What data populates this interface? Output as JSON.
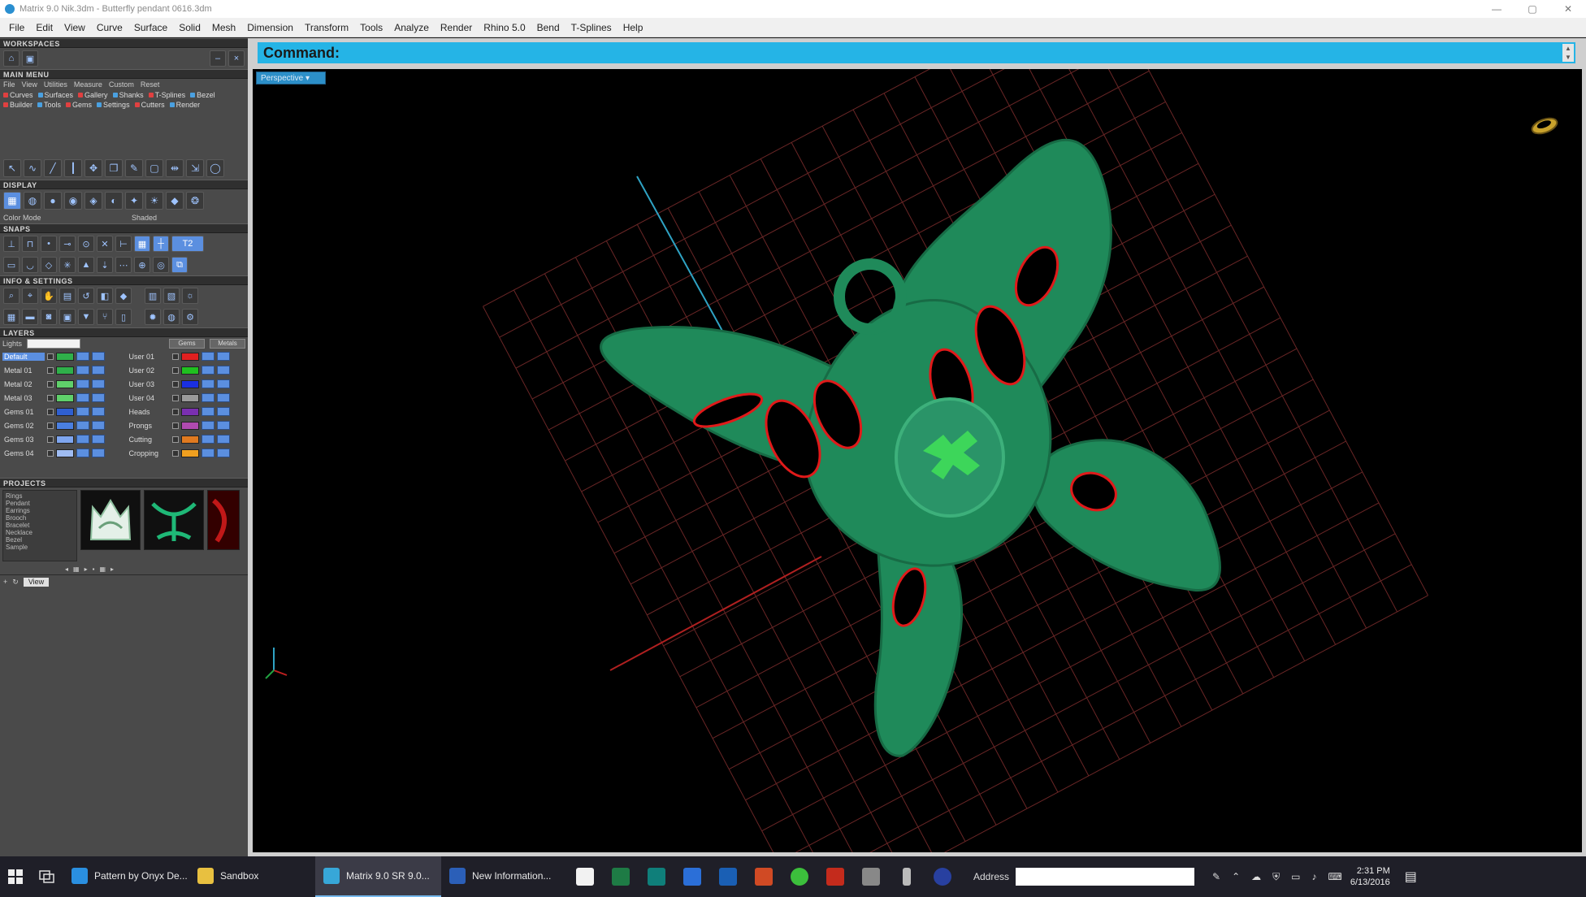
{
  "window": {
    "title": "Matrix 9.0 Nik.3dm - Butterfly pendant 0616.3dm",
    "min": "—",
    "max": "▢",
    "close": "✕"
  },
  "menu": [
    "File",
    "Edit",
    "View",
    "Curve",
    "Surface",
    "Solid",
    "Mesh",
    "Dimension",
    "Transform",
    "Tools",
    "Analyze",
    "Render",
    "Rhino 5.0",
    "Bend",
    "T-Splines",
    "Help"
  ],
  "left_panel": {
    "sections": {
      "workspaces": "WORKSPACES",
      "main_menu": "MAIN MENU",
      "display": "DISPLAY",
      "snaps": "SNAPS",
      "info_settings": "INFO & SETTINGS",
      "layers": "LAYERS",
      "projects": "PROJECTS"
    },
    "main_menu_tabs": [
      "File",
      "View",
      "Utilities",
      "Measure",
      "Custom",
      "Reset"
    ],
    "main_menu_chips": [
      {
        "label": "Curves",
        "color": "#e04040"
      },
      {
        "label": "Surfaces",
        "color": "#4aa0e0"
      },
      {
        "label": "Gallery",
        "color": "#e04040"
      },
      {
        "label": "Shanks",
        "color": "#4aa0e0"
      },
      {
        "label": "T-Splines",
        "color": "#e04040"
      },
      {
        "label": "Bezel",
        "color": "#4aa0e0"
      },
      {
        "label": "Builder",
        "color": "#e04040"
      },
      {
        "label": "Tools",
        "color": "#4aa0e0"
      },
      {
        "label": "Gems",
        "color": "#e04040"
      },
      {
        "label": "Settings",
        "color": "#4aa0e0"
      },
      {
        "label": "Cutters",
        "color": "#e04040"
      },
      {
        "label": "Render",
        "color": "#4aa0e0"
      }
    ],
    "display_labels": [
      "Color Mode",
      "Shaded"
    ],
    "snaps_value": "T2",
    "layers_top": {
      "label": "Lights",
      "btn1": "Gems",
      "btn2": "Metals"
    },
    "layers_left": [
      {
        "name": "Default",
        "color": "#2fb04a",
        "selected": true
      },
      {
        "name": "Metal 01",
        "color": "#2fb04a"
      },
      {
        "name": "Metal 02",
        "color": "#5fd06a"
      },
      {
        "name": "Metal 03",
        "color": "#5fd06a"
      },
      {
        "name": "Gems 01",
        "color": "#2f5fd0"
      },
      {
        "name": "Gems 02",
        "color": "#4a7fe0"
      },
      {
        "name": "Gems 03",
        "color": "#7fa6ef"
      },
      {
        "name": "Gems 04",
        "color": "#9fbcf2"
      }
    ],
    "layers_right": [
      {
        "name": "User 01",
        "color": "#e02020"
      },
      {
        "name": "User 02",
        "color": "#20c020"
      },
      {
        "name": "User 03",
        "color": "#1a2fe0"
      },
      {
        "name": "User 04",
        "color": "#9a9a9a"
      },
      {
        "name": "Heads",
        "color": "#7a2fb0"
      },
      {
        "name": "Prongs",
        "color": "#b04ab0"
      },
      {
        "name": "Cutting",
        "color": "#e07a20"
      },
      {
        "name": "Cropping",
        "color": "#f0a020"
      }
    ],
    "projects_list": [
      "Rings",
      "Pendant",
      "Earrings",
      "Brooch",
      "Bracelet",
      "Necklace",
      "Bezel",
      "Sample"
    ],
    "projects_footer": {
      "view": "View"
    }
  },
  "command": {
    "label": "Command:",
    "value": ""
  },
  "viewport": {
    "mode": "Perspective ▾",
    "model_color": "#1f8a5a",
    "cutout_color": "#e01a1a",
    "logo_color": "#3dd65a",
    "grid_color": "#6a2626"
  },
  "taskbar": {
    "tasks": [
      {
        "label": "Pattern by Onyx De...",
        "icon": "edge-icon",
        "color": "#2a8fe0",
        "active": false
      },
      {
        "label": "Sandbox",
        "icon": "folder-icon",
        "color": "#e8c040",
        "active": false
      },
      {
        "label": "Matrix 9.0 SR 9.0...",
        "icon": "matrix-icon",
        "color": "#37a7d8",
        "active": true
      },
      {
        "label": "New Information...",
        "icon": "word-icon",
        "color": "#2b5fb8",
        "active": false
      }
    ],
    "address_label": "Address",
    "address_value": "",
    "clock_time": "2:31 PM",
    "clock_date": "6/13/2016"
  }
}
